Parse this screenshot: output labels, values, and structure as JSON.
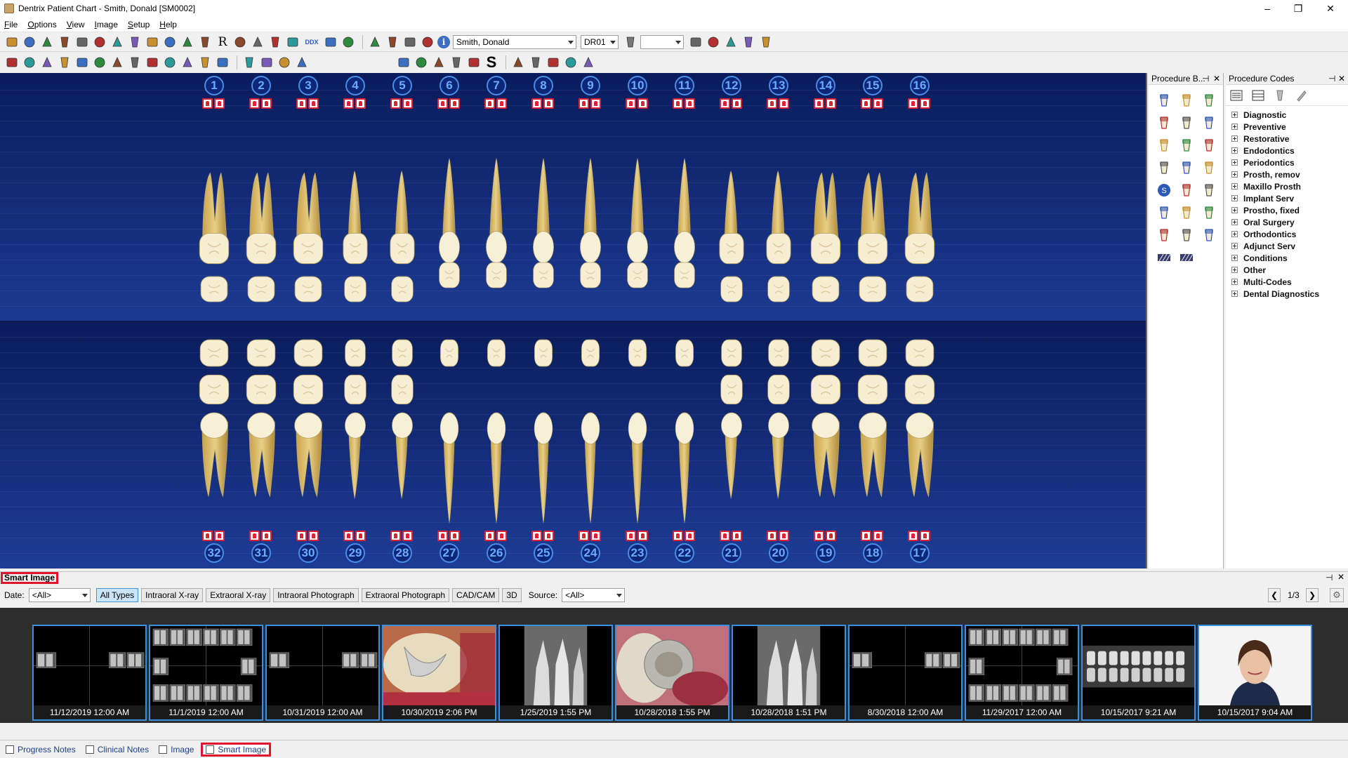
{
  "window": {
    "title": "Dentrix Patient Chart - Smith, Donald [SM0002]"
  },
  "menu": [
    "File",
    "Options",
    "View",
    "Image",
    "Setup",
    "Help"
  ],
  "toolbar": {
    "patient_name": "Smith, Donald",
    "provider": "DR01",
    "second_combo": "",
    "ddx_label": "DDX"
  },
  "chart": {
    "upper_teeth": [
      "1",
      "2",
      "3",
      "4",
      "5",
      "6",
      "7",
      "8",
      "9",
      "10",
      "11",
      "12",
      "13",
      "14",
      "15",
      "16"
    ],
    "lower_teeth": [
      "32",
      "31",
      "30",
      "29",
      "28",
      "27",
      "26",
      "25",
      "24",
      "23",
      "22",
      "21",
      "20",
      "19",
      "18",
      "17"
    ]
  },
  "procedure_buttons": {
    "title": "Procedure B...",
    "pin": "⊣",
    "close": "✕"
  },
  "procedure_codes": {
    "title": "Procedure Codes",
    "pin": "⊣",
    "close": "✕",
    "categories": [
      "Diagnostic",
      "Preventive",
      "Restorative",
      "Endodontics",
      "Periodontics",
      "Prosth, remov",
      "Maxillo Prosth",
      "Implant Serv",
      "Prostho, fixed",
      "Oral Surgery",
      "Orthodontics",
      "Adjunct Serv",
      "Conditions",
      "Other",
      "Multi-Codes",
      "Dental Diagnostics"
    ]
  },
  "smart_image": {
    "title": "Smart Image",
    "date_label": "Date:",
    "date_value": "<All>",
    "types": [
      "All Types",
      "Intraoral X-ray",
      "Extraoral X-ray",
      "Intraoral Photograph",
      "Extraoral Photograph",
      "CAD/CAM",
      "3D"
    ],
    "source_label": "Source:",
    "source_value": "<All>",
    "page": "1/3",
    "thumbnails": [
      {
        "date": "11/12/2019 12:00 AM",
        "kind": "fmx-sparse"
      },
      {
        "date": "11/1/2019 12:00 AM",
        "kind": "fmx-full"
      },
      {
        "date": "10/31/2019 12:00 AM",
        "kind": "fmx-sparse"
      },
      {
        "date": "10/30/2019 2:06 PM",
        "kind": "intraoral-photo"
      },
      {
        "date": "1/25/2019 1:55 PM",
        "kind": "periapical-xray"
      },
      {
        "date": "10/28/2018 1:55 PM",
        "kind": "intraoral-photo-crown"
      },
      {
        "date": "10/28/2018 1:51 PM",
        "kind": "periapical-xray"
      },
      {
        "date": "8/30/2018 12:00 AM",
        "kind": "fmx-sparse"
      },
      {
        "date": "11/29/2017 12:00 AM",
        "kind": "fmx-full"
      },
      {
        "date": "10/15/2017 9:21 AM",
        "kind": "panoramic"
      },
      {
        "date": "10/15/2017 9:04 AM",
        "kind": "portrait"
      }
    ]
  },
  "bottom_tabs": [
    "Progress Notes",
    "Clinical Notes",
    "Image",
    "Smart Image"
  ],
  "colors": {
    "chart_bg": "#1c3a92",
    "accent_red": "#e0142c",
    "thumb_border": "#3a8fe0"
  }
}
